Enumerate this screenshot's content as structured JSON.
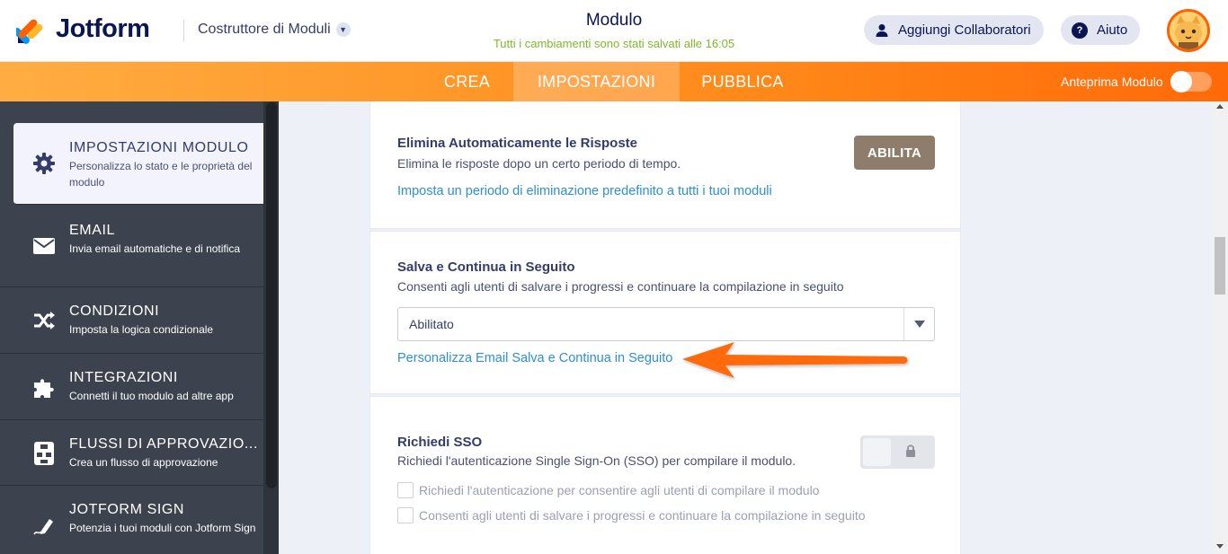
{
  "header": {
    "brand": "Jotform",
    "builder_label": "Costruttore di Moduli",
    "form_title": "Modulo",
    "saved_status": "Tutti i cambiamenti sono stati salvati alle 16:05",
    "collaborators_label": "Aggiungi Collaboratori",
    "help_label": "Aiuto"
  },
  "nav": {
    "tabs": [
      {
        "label": "CREA"
      },
      {
        "label": "IMPOSTAZIONI",
        "active": true
      },
      {
        "label": "PUBBLICA"
      }
    ],
    "preview_label": "Anteprima Modulo"
  },
  "sidebar": {
    "items": [
      {
        "title": "IMPOSTAZIONI MODULO",
        "desc": "Personalizza lo stato e le proprietà del modulo",
        "icon": "gear-icon",
        "active": true
      },
      {
        "title": "EMAIL",
        "desc": "Invia email automatiche e di notifica",
        "icon": "envelope-icon"
      },
      {
        "title": "CONDIZIONI",
        "desc": "Imposta la logica condizionale",
        "icon": "shuffle-icon"
      },
      {
        "title": "INTEGRAZIONI",
        "desc": "Connetti il tuo modulo ad altre app",
        "icon": "puzzle-icon"
      },
      {
        "title": "FLUSSI DI APPROVAZIO...",
        "desc": "Crea un flusso di approvazione",
        "icon": "flow-icon"
      },
      {
        "title": "JOTFORM SIGN",
        "desc": "Potenzia i tuoi moduli con Jotform Sign",
        "icon": "pen-icon"
      }
    ]
  },
  "settings": {
    "auto_delete": {
      "title": "Elimina Automaticamente le Risposte",
      "desc": "Elimina le risposte dopo un certo periodo di tempo.",
      "button": "ABILITA",
      "link": "Imposta un periodo di eliminazione predefinito a tutti i tuoi moduli"
    },
    "save_continue": {
      "title": "Salva e Continua in Seguito",
      "desc": "Consenti agli utenti di salvare i progressi e continuare la compilazione in seguito",
      "selected": "Abilitato",
      "link": "Personalizza Email Salva e Continua in Seguito"
    },
    "sso": {
      "title": "Richiedi SSO",
      "desc": "Richiedi l'autenticazione Single Sign-On (SSO) per compilare il modulo.",
      "options": [
        "Richiedi l'autenticazione per consentire agli utenti di compilare il modulo",
        "Consenti agli utenti di salvare i progressi e continuare la compilazione in seguito"
      ]
    }
  },
  "colors": {
    "accent_orange": "#ff6100",
    "link_blue": "#2b8fda",
    "saved_green": "#7fb82b",
    "enable_button": "#8d7d6a",
    "sidebar_bg": "#3d434e"
  }
}
